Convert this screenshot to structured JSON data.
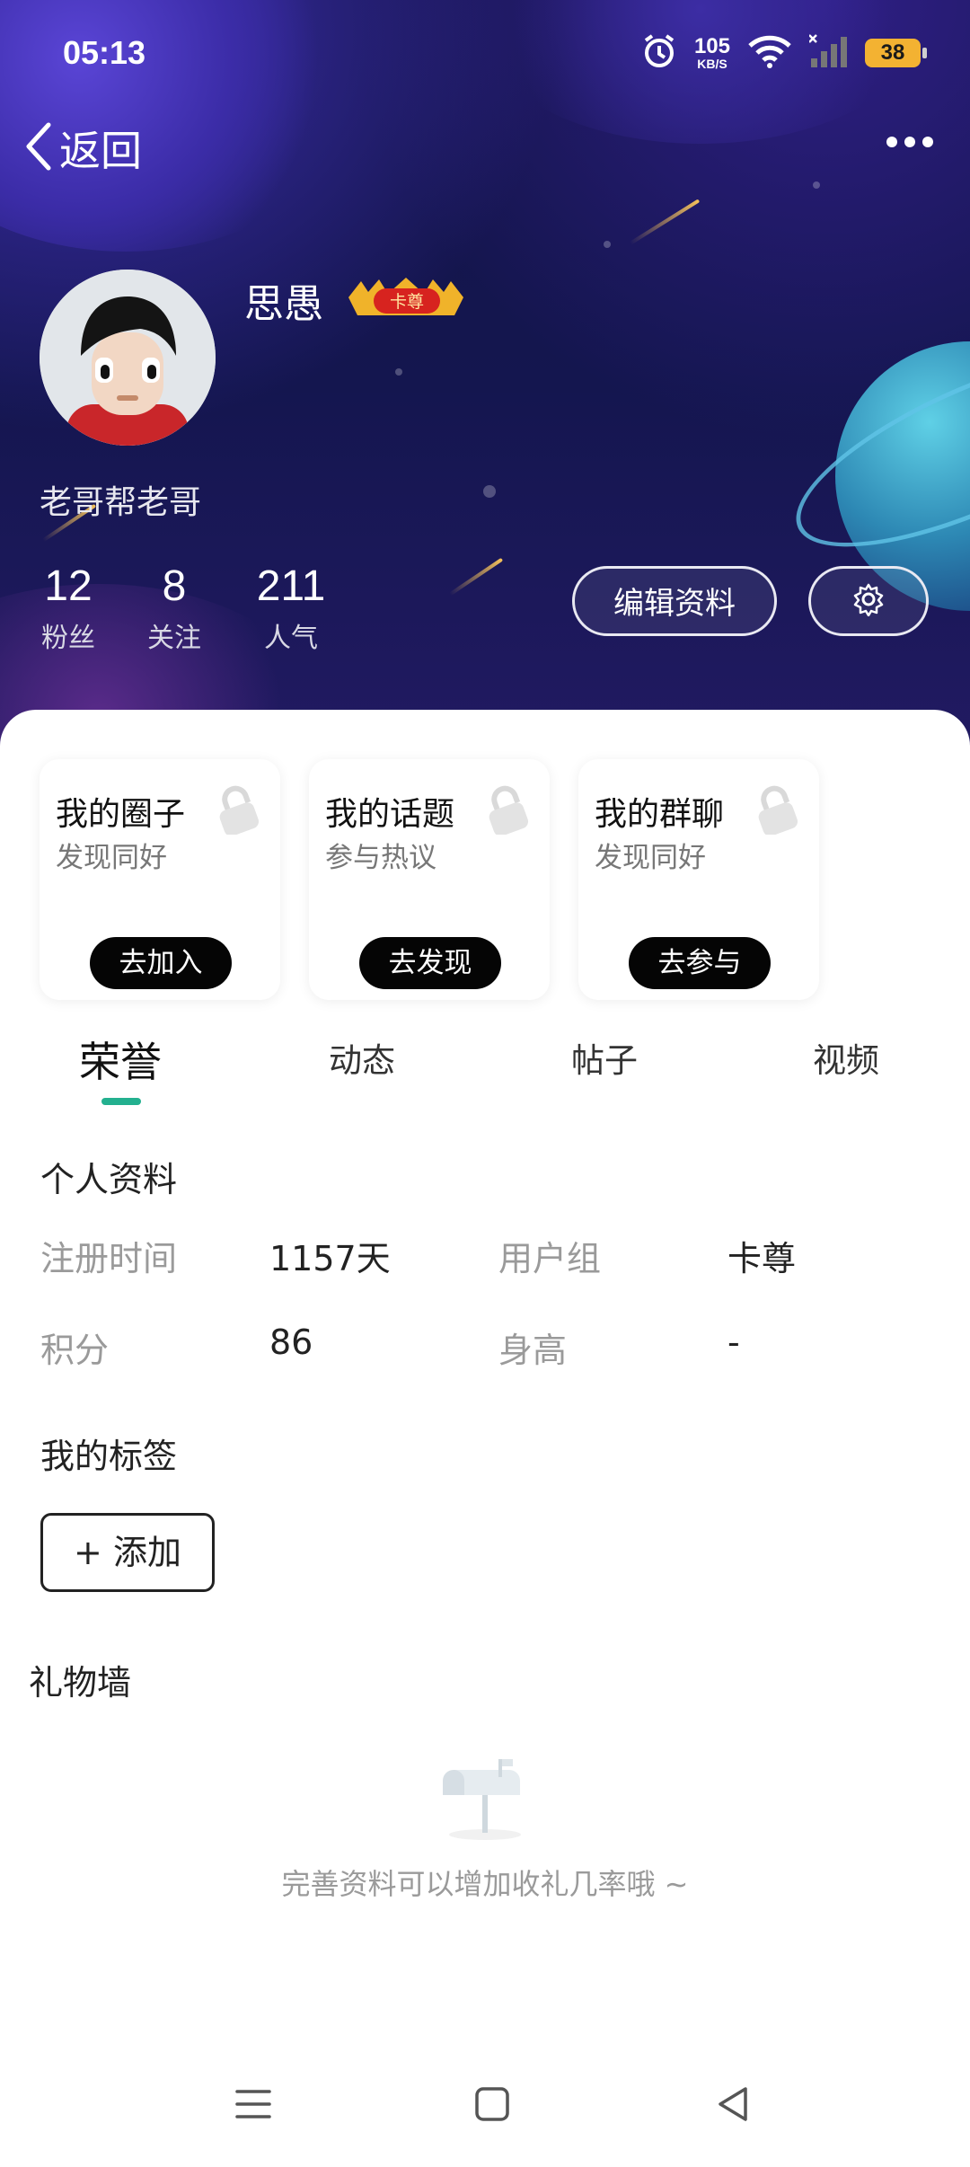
{
  "status_bar": {
    "time": "05:13",
    "net_speed_value": "105",
    "net_speed_unit": "KB/S",
    "battery": "38",
    "icons": [
      "alarm-icon",
      "wifi-icon",
      "signal-icon",
      "battery-icon"
    ]
  },
  "header": {
    "back_label": "返回",
    "more_icon": "more-dots-icon"
  },
  "profile": {
    "username": "思愚",
    "badge_text": "卡尊",
    "bio": "老哥帮老哥",
    "stats": [
      {
        "value": "12",
        "label": "粉丝"
      },
      {
        "value": "8",
        "label": "关注"
      },
      {
        "value": "211",
        "label": "人气"
      }
    ],
    "edit_button": "编辑资料",
    "settings_icon": "gear-icon"
  },
  "cards": [
    {
      "title": "我的圈子",
      "subtitle": "发现同好",
      "action": "去加入"
    },
    {
      "title": "我的话题",
      "subtitle": "参与热议",
      "action": "去发现"
    },
    {
      "title": "我的群聊",
      "subtitle": "发现同好",
      "action": "去参与"
    }
  ],
  "tabs": [
    {
      "label": "荣誉",
      "active": true
    },
    {
      "label": "动态",
      "active": false
    },
    {
      "label": "帖子",
      "active": false
    },
    {
      "label": "视频",
      "active": false
    }
  ],
  "accent_color": "#23b08f",
  "personal_info": {
    "title": "个人资料",
    "fields": [
      {
        "label": "注册时间",
        "value": "1157天"
      },
      {
        "label": "用户组",
        "value": "卡尊"
      },
      {
        "label": "积分",
        "value": "86"
      },
      {
        "label": "身高",
        "value": "-"
      }
    ]
  },
  "tags": {
    "title": "我的标签",
    "add_label": "+ 添加"
  },
  "gift_wall": {
    "title": "礼物墙",
    "empty_hint": "完善资料可以增加收礼几率哦 ~"
  },
  "nav_bar": {
    "icons": [
      "menu-icon",
      "home-icon",
      "back-icon"
    ]
  }
}
